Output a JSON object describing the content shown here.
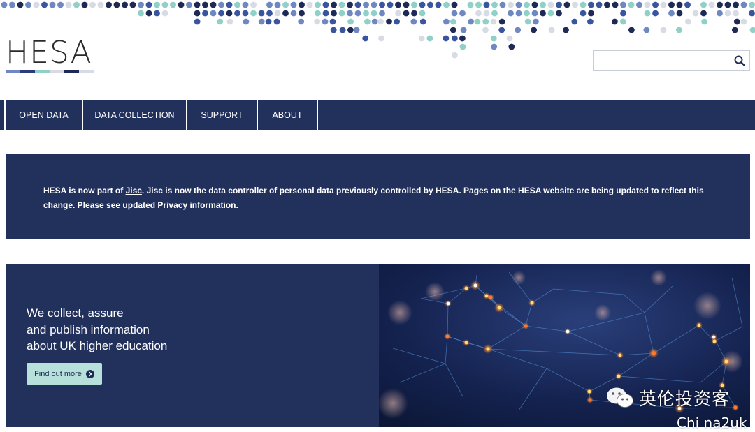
{
  "header": {
    "logo_text": "HESA",
    "logo_bar_colors": [
      "#6f88c2",
      "#2c3c7a",
      "#8fd1c6",
      "#d9dbe4",
      "#1e2a55",
      "#d9dbe4"
    ],
    "dot_palette": [
      "#1e2a55",
      "#3a55a0",
      "#6f88c2",
      "#8fd1c6",
      "#d9dbe4"
    ],
    "search": {
      "placeholder": "",
      "value": "",
      "icon": "search-icon"
    }
  },
  "nav": {
    "items": [
      {
        "label": "OPEN DATA"
      },
      {
        "label": "DATA COLLECTION"
      },
      {
        "label": "SUPPORT"
      },
      {
        "label": "ABOUT"
      }
    ]
  },
  "notice": {
    "text1": "HESA is now part of ",
    "link1": "Jisc",
    "text2": ". Jisc is now the data controller of personal data previously controlled by HESA. Pages on the HESA website are being updated to reflect this change. Please see updated ",
    "link2": "Privacy information",
    "text3": "."
  },
  "hero": {
    "lines": [
      "We collect, assure",
      "and publish information",
      "about UK higher education"
    ],
    "button_label": "Find out more",
    "button_icon": "arrow-circle-right-icon"
  },
  "watermark": {
    "text": "英伦投资客",
    "subtext": "Chi na2uk",
    "icon": "wechat-icon"
  },
  "colors": {
    "navy": "#22305c",
    "mint": "#b7e0da",
    "white": "#ffffff"
  }
}
